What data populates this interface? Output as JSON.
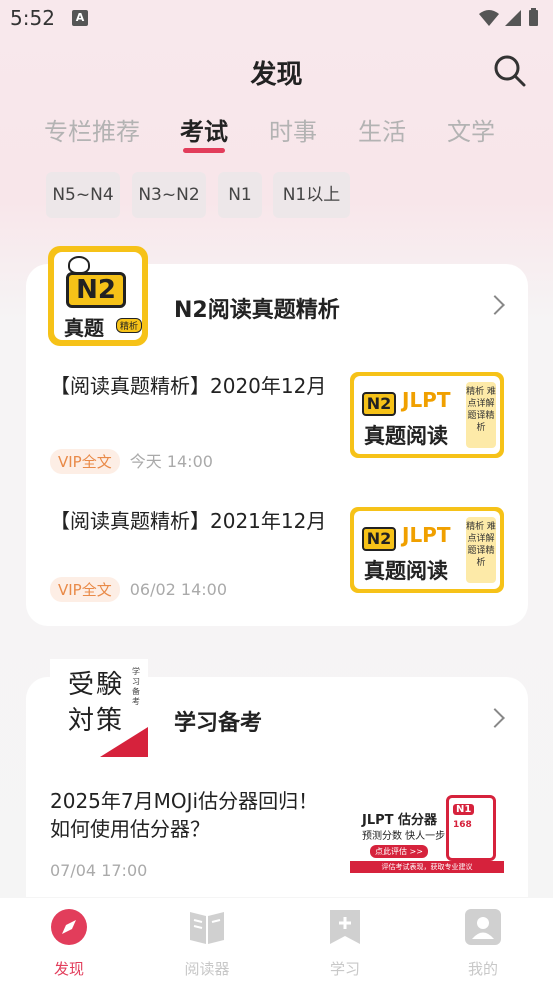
{
  "status_bar": {
    "time": "5:52",
    "a_icon": "A"
  },
  "header": {
    "title": "发现"
  },
  "tabs": [
    {
      "label": "专栏推荐"
    },
    {
      "label": "考试"
    },
    {
      "label": "时事"
    },
    {
      "label": "生活"
    },
    {
      "label": "文学"
    }
  ],
  "chips": [
    {
      "label": "N5~N4"
    },
    {
      "label": "N3~N2"
    },
    {
      "label": "N1"
    },
    {
      "label": "N1以上"
    }
  ],
  "column1": {
    "cover": {
      "badge": "N2",
      "text": "真题",
      "tag": "精析"
    },
    "title": "N2阅读真题精析",
    "articles": [
      {
        "title": "【阅读真题精析】2020年12月",
        "badge": "VIP全文",
        "time": "今天 14:00",
        "thumb_main": "真题阅读",
        "thumb_jlpt": "JLPT",
        "thumb_n2": "N2",
        "thumb_side": "精析 难点详解 题译精析"
      },
      {
        "title": "【阅读真题精析】2021年12月",
        "badge": "VIP全文",
        "time": "06/02 14:00",
        "thumb_main": "真题阅读",
        "thumb_jlpt": "JLPT",
        "thumb_n2": "N2",
        "thumb_side": "精析 难点详解 题译精析"
      }
    ]
  },
  "column2": {
    "cover": {
      "line1": "受験",
      "line2": "対策",
      "small": "学习备考"
    },
    "title": "学习备考",
    "article": {
      "title": "2025年7月MOJi估分器回归！如何使用估分器？",
      "time": "07/04 17:00",
      "thumb_title": "JLPT 估分器",
      "thumb_sub": "预测分数 快人一步",
      "thumb_btn": "点此评估 >>",
      "thumb_bar": "评估考试表现，获取专业建议",
      "thumb_n1": "N1",
      "thumb_score": "168"
    }
  },
  "tabbar": [
    {
      "label": "发现",
      "icon": "compass-icon"
    },
    {
      "label": "阅读器",
      "icon": "book-icon"
    },
    {
      "label": "学习",
      "icon": "bookmark-plus-icon"
    },
    {
      "label": "我的",
      "icon": "person-icon"
    }
  ],
  "colors": {
    "accent": "#e23d5b",
    "yellow": "#f6c218",
    "vip_text": "#e98a48",
    "moji_red": "#d6223c"
  }
}
